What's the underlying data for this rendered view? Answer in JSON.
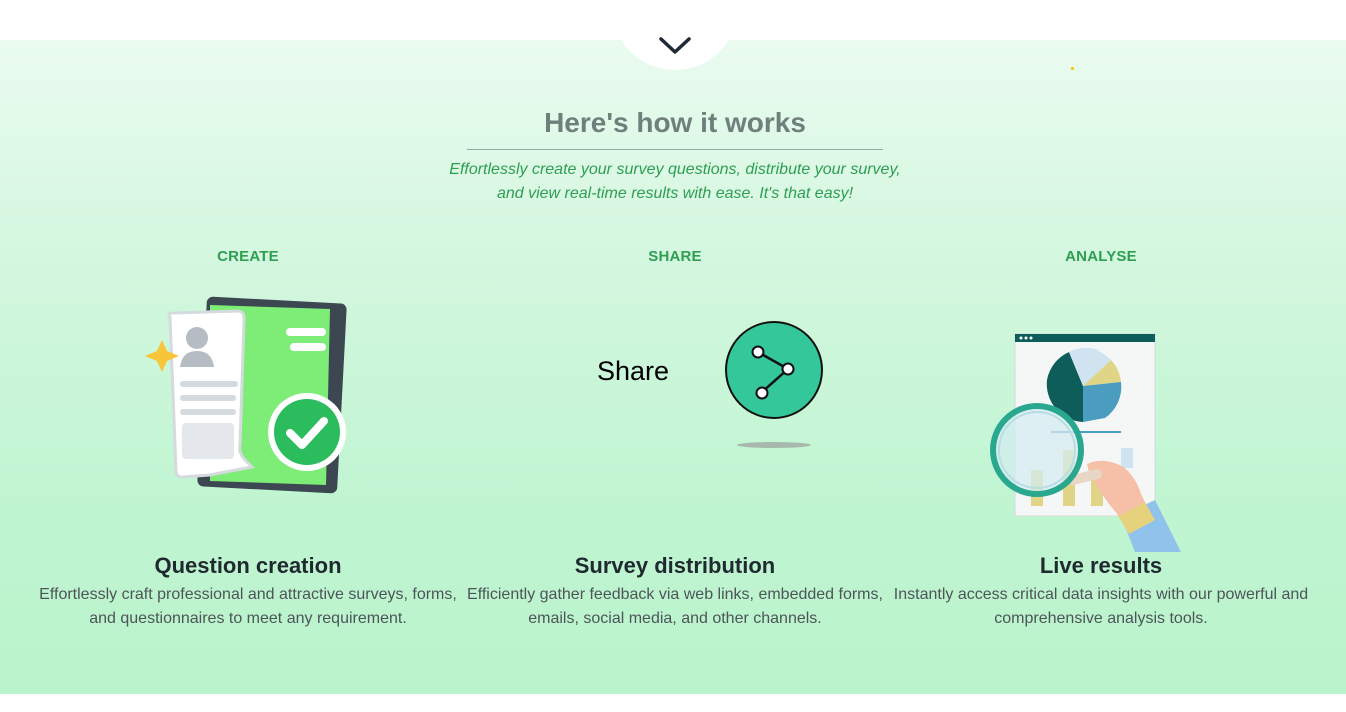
{
  "nav": {
    "scroll_icon": "chevron-down-icon"
  },
  "section": {
    "heading": "Here's how it works",
    "subtitle": "Effortlessly create your survey questions, distribute your survey, and view real-time results with ease. It's that easy!"
  },
  "steps": [
    {
      "label": "CREATE",
      "title": "Question creation",
      "description": "Effortlessly craft professional and attractive surveys, forms, and questionnaires to meet any requirement.",
      "icon": "document-check-icon"
    },
    {
      "label": "SHARE",
      "title": "Survey distribution",
      "description": "Efficiently gather feedback via web links, embedded forms, emails, social media, and other channels.",
      "illustration_text": "Share",
      "icon": "share-icon"
    },
    {
      "label": "ANALYSE",
      "title": "Live results",
      "description": "Instantly access critical data insights with our powerful and comprehensive analysis tools.",
      "icon": "magnifier-chart-icon"
    }
  ],
  "colors": {
    "accent_green": "#2e9e52",
    "heading_grey": "#6f7f7c",
    "share_teal": "#34c79a"
  }
}
